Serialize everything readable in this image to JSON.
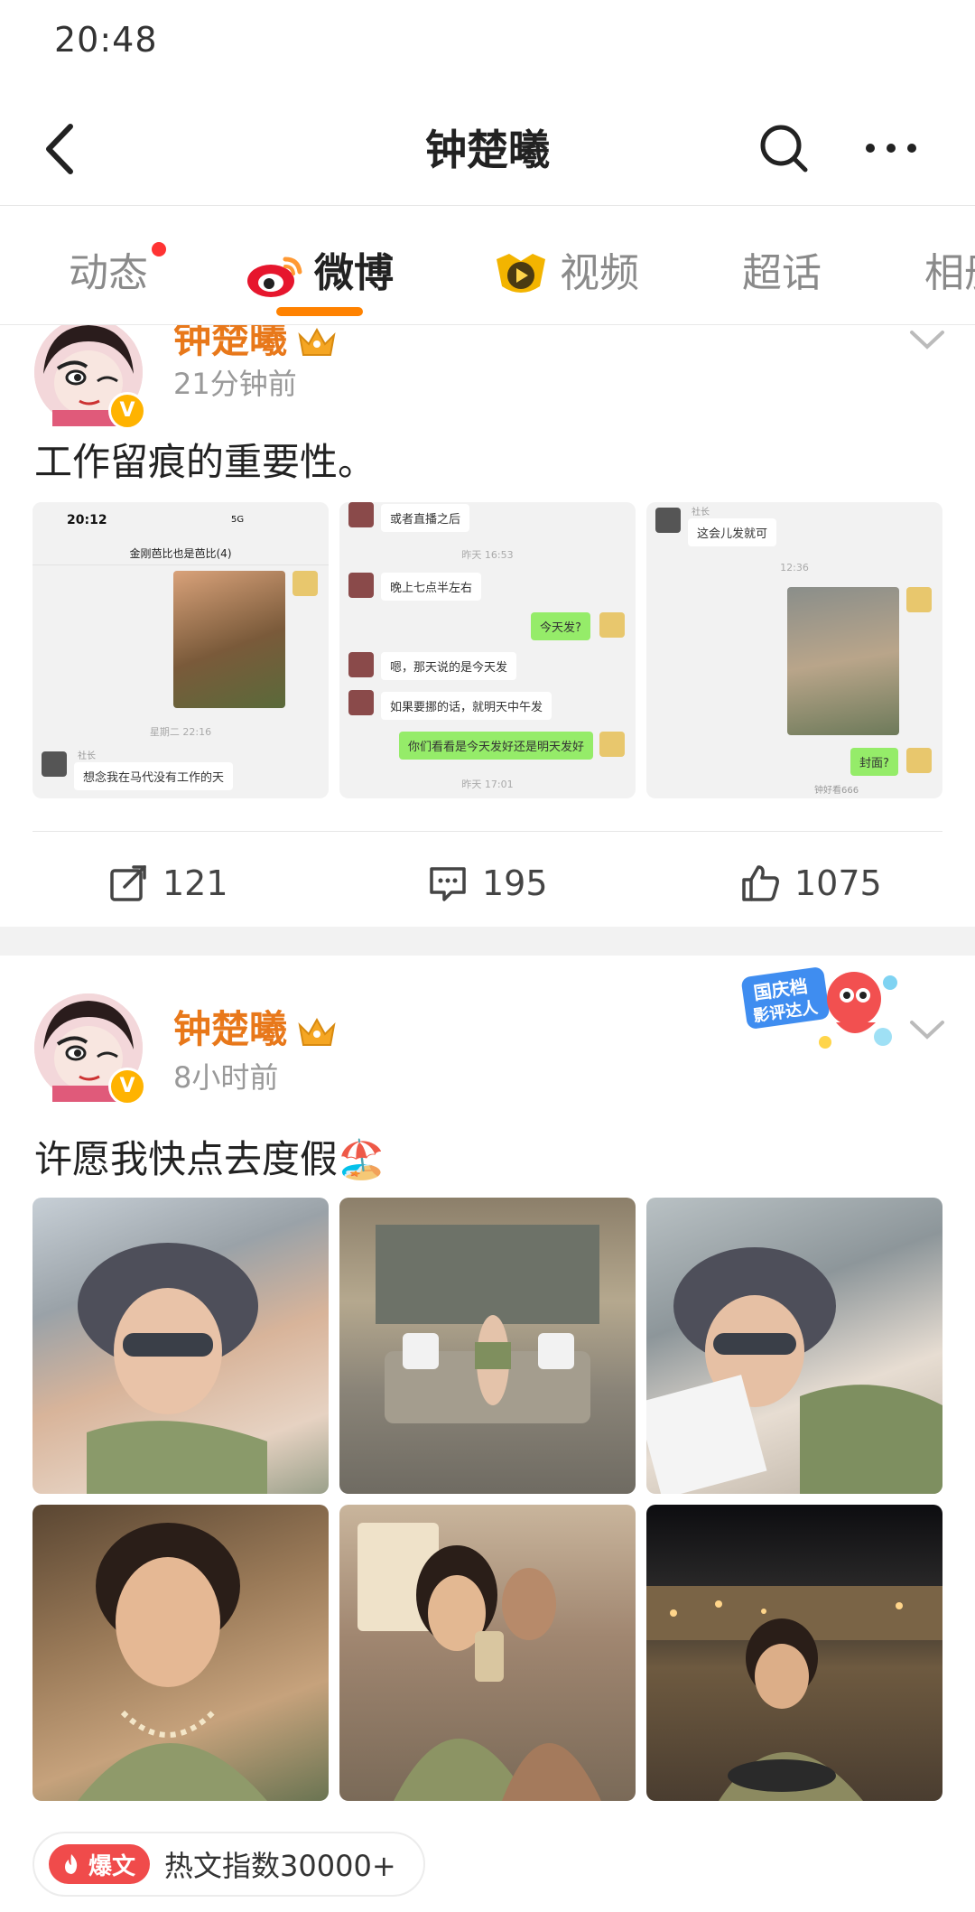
{
  "status_bar": {
    "time": "20:48"
  },
  "nav": {
    "title": "钟楚曦"
  },
  "tabs": [
    {
      "label": "动态",
      "has_dot": true
    },
    {
      "label": "微博",
      "active": true
    },
    {
      "label": "视频"
    },
    {
      "label": "超话"
    },
    {
      "label": "相册"
    }
  ],
  "post1": {
    "username": "钟楚曦",
    "time": "21分钟前",
    "text": "工作留痕的重要性。",
    "shot1": {
      "time": "20:12",
      "signal": "5G",
      "chat_name": "金刚芭比也是芭比(4)",
      "timestamp": "星期二 22:16",
      "sender": "社长",
      "message": "想念我在马代没有工作的天"
    },
    "shot2": {
      "msg1": "或者直播之后",
      "time1": "昨天 16:53",
      "msg2": "晚上七点半左右",
      "msg3": "今天发?",
      "msg4": "嗯，那天说的是今天发",
      "msg5": "如果要挪的话，就明天中午发",
      "msg6": "你们看看是今天发好还是明天发好",
      "time2": "昨天 17:01"
    },
    "shot3": {
      "sender": "社长",
      "msg1": "这会儿发就可",
      "time1": "12:36",
      "msg2": "封面?",
      "msg3": "钟好看666"
    },
    "share_count": "121",
    "comment_count": "195",
    "like_count": "1075"
  },
  "post2": {
    "username": "钟楚曦",
    "time": "8小时前",
    "text": "许愿我快点去度假🏖️",
    "badge_line1": "国庆档",
    "badge_line2": "影评达人",
    "hot_tag": "爆文",
    "hot_text": "热文指数30000+"
  },
  "colors": {
    "accent": "#ff8200",
    "username": "#e8781a",
    "hot": "#f04b4b"
  }
}
